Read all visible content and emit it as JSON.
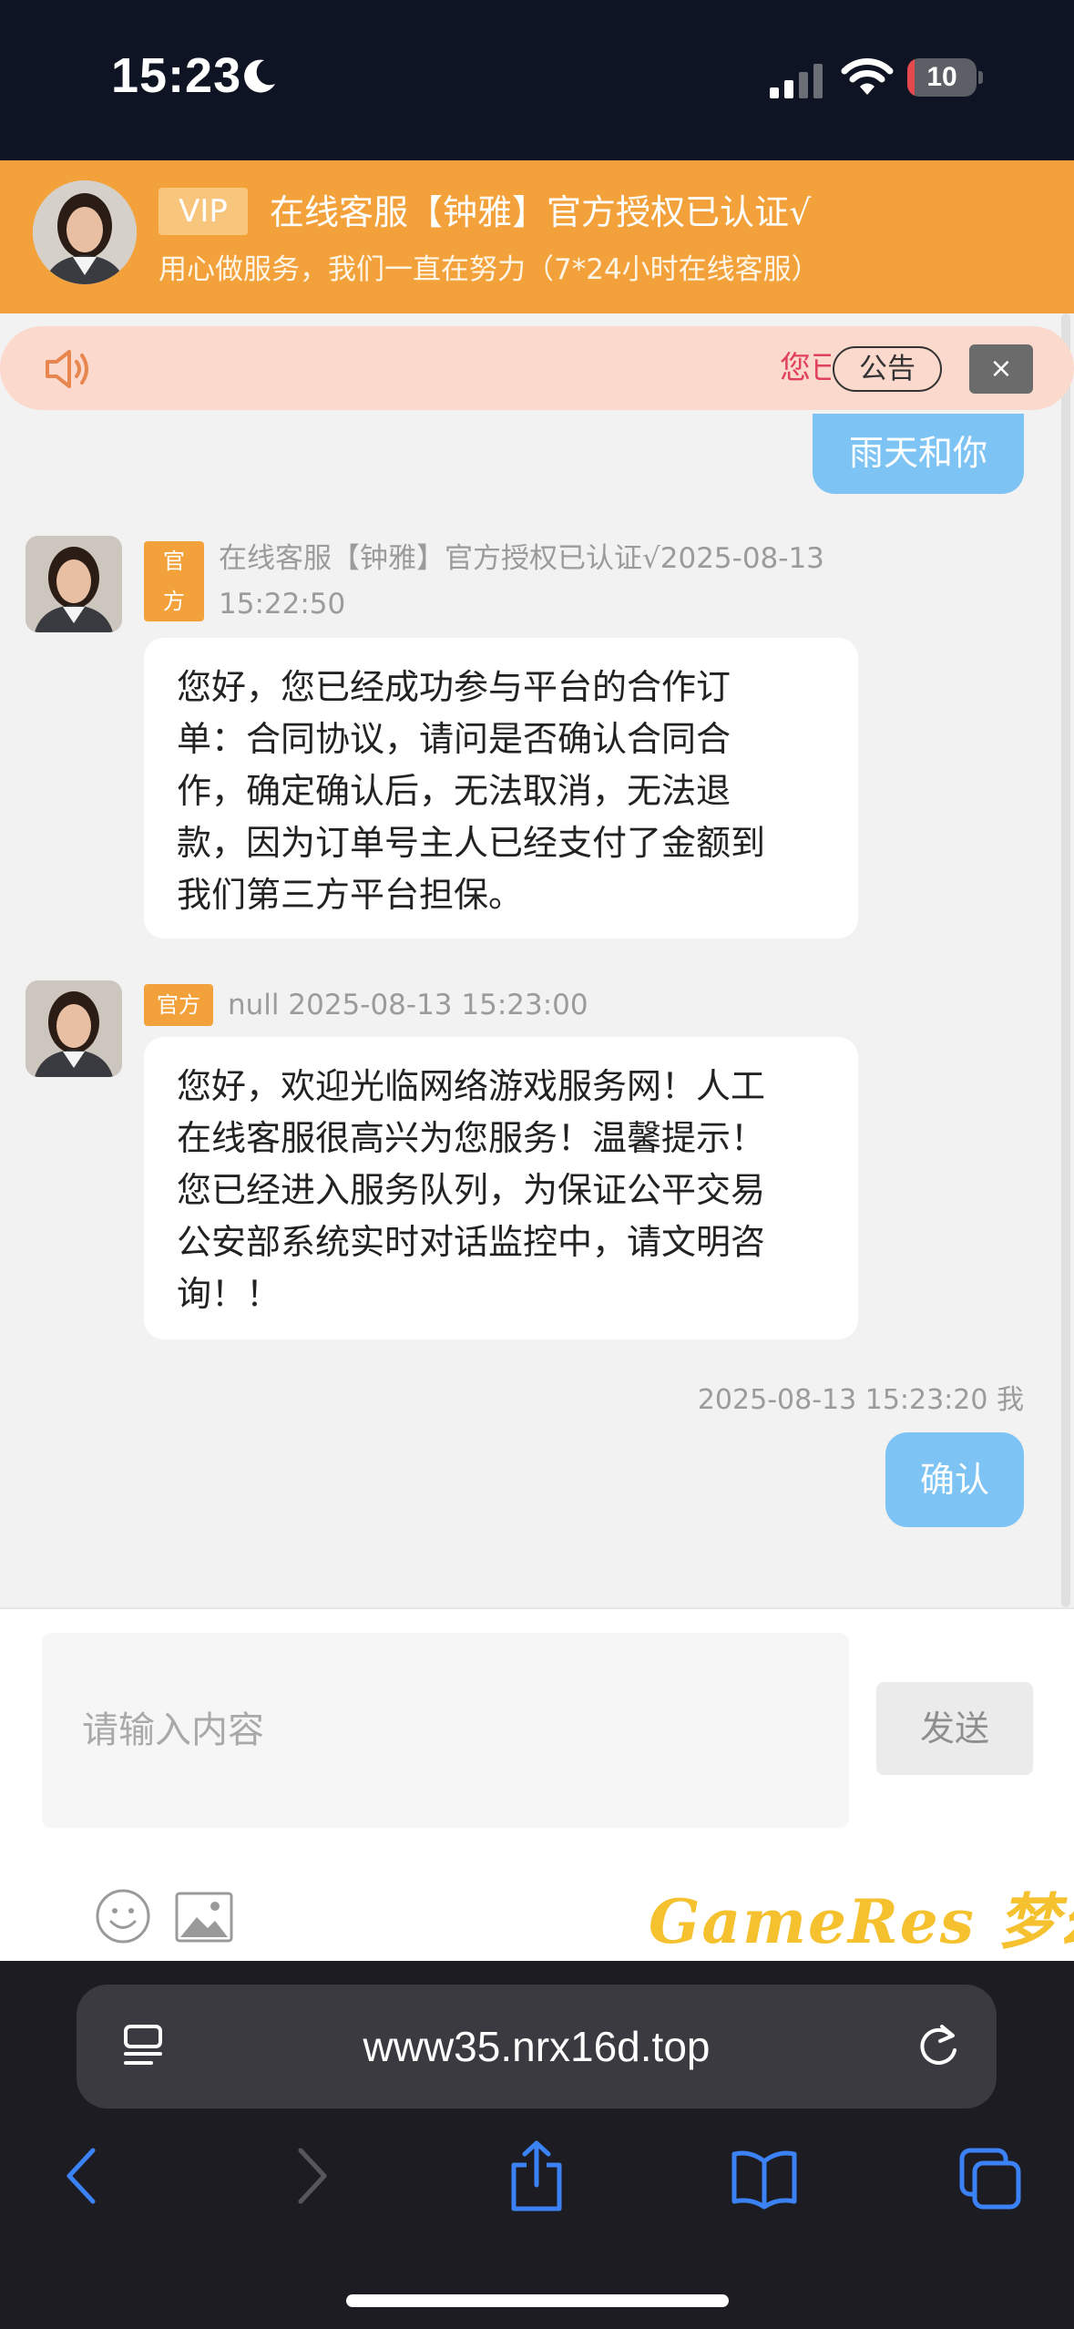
{
  "status_bar": {
    "time": "15:23",
    "battery": "10",
    "battery_fraction": 0.1
  },
  "header": {
    "vip": "VIP",
    "title": "在线客服【钟雅】官方授权已认证√",
    "subtitle": "用心做服务，我们一直在努力（7*24小时在线客服）"
  },
  "notice": {
    "text": "您已",
    "button": "公告",
    "close": "×",
    "icon": "speaker-icon"
  },
  "messages": [
    {
      "side": "right",
      "text": "雨天和你"
    },
    {
      "side": "left",
      "tag": "官方",
      "meta_line1": "在线客服【钟雅】官方授权已认证√2025-08-13",
      "meta_line2": "15:22:50",
      "lines": [
        "您好，您已经成功参与平台的合作订",
        "单：合同协议，请问是否确认合同合",
        "作，确定确认后，无法取消，无法退",
        "款，因为订单号主人已经支付了金额到",
        "我们第三方平台担保。"
      ]
    },
    {
      "side": "left",
      "tag": "官方",
      "meta_line1": "null 2025-08-13 15:23:00",
      "lines": [
        "您好，欢迎光临网络游戏服务网！人工",
        "在线客服很高兴为您服务！温馨提示！",
        "您已经进入服务队列，为保证公平交易",
        "公安部系统实时对话监控中，请文明咨",
        "询！！"
      ]
    },
    {
      "side": "right",
      "meta": "2025-08-13 15:23:20 我",
      "text": "确认"
    }
  ],
  "input": {
    "placeholder": "请输入内容",
    "send_label": "发送"
  },
  "watermark": "GameRes 梦幻",
  "browser": {
    "url": "www35.nrx16d.top"
  },
  "colors": {
    "header": "#f3a23b",
    "bubble_self": "#7dc4f4",
    "notice_bg": "#fbd9cd",
    "watermark": "#f5c12e"
  }
}
